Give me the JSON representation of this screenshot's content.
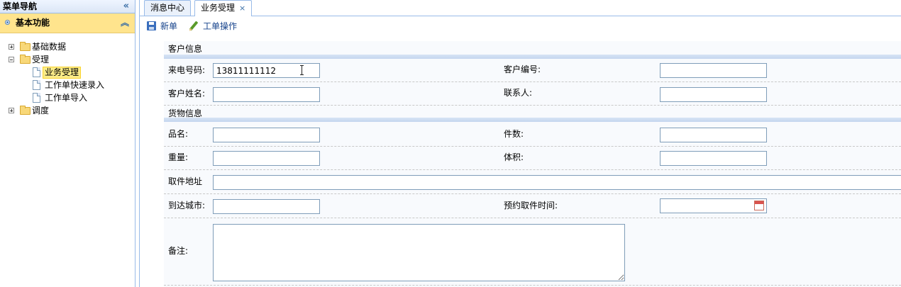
{
  "sidebar": {
    "title": "菜单导航",
    "collapse_glyph": "«",
    "accordion": {
      "title": "基本功能",
      "toggle_glyph": "︽"
    },
    "tree": [
      {
        "label": "基础数据",
        "type": "folder",
        "state": "collapsed"
      },
      {
        "label": "受理",
        "type": "folder",
        "state": "expanded",
        "children": [
          {
            "label": "业务受理",
            "type": "file",
            "selected": true
          },
          {
            "label": "工作单快速录入",
            "type": "file"
          },
          {
            "label": "工作单导入",
            "type": "file"
          }
        ]
      },
      {
        "label": "调度",
        "type": "folder",
        "state": "collapsed"
      }
    ]
  },
  "tabs": [
    {
      "label": "消息中心",
      "active": false
    },
    {
      "label": "业务受理",
      "active": true,
      "close_glyph": "×"
    }
  ],
  "toolbar": {
    "new_label": "新单",
    "workorder_label": "工单操作"
  },
  "form": {
    "section_customer": "客户信息",
    "section_goods": "货物信息",
    "fields": {
      "phone": {
        "label": "来电号码:",
        "value": "13811111112"
      },
      "customer_no": {
        "label": "客户编号:",
        "value": ""
      },
      "customer_name": {
        "label": "客户姓名:",
        "value": ""
      },
      "contact": {
        "label": "联系人:",
        "value": ""
      },
      "product_name": {
        "label": "品名:",
        "value": ""
      },
      "pieces": {
        "label": "件数:",
        "value": ""
      },
      "weight": {
        "label": "重量:",
        "value": ""
      },
      "volume": {
        "label": "体积:",
        "value": ""
      },
      "pickup_address": {
        "label": "取件地址",
        "value": ""
      },
      "dest_city": {
        "label": "到达城市:",
        "value": ""
      },
      "appointment_time": {
        "label": "预约取件时间:",
        "value": ""
      },
      "remarks": {
        "label": "备注:",
        "value": ""
      }
    }
  },
  "colors": {
    "accordion_header": "#ffe48d",
    "selected_node": "#fbec88",
    "border_blue": "#99bbe8",
    "toolbar_text": "#15428b"
  },
  "icons": [
    "collapse-left-icon",
    "accordion-dot-icon",
    "accordion-collapse-icon",
    "folder-icon",
    "file-icon",
    "save-icon",
    "pencil-icon",
    "calendar-icon",
    "text-cursor-icon"
  ]
}
